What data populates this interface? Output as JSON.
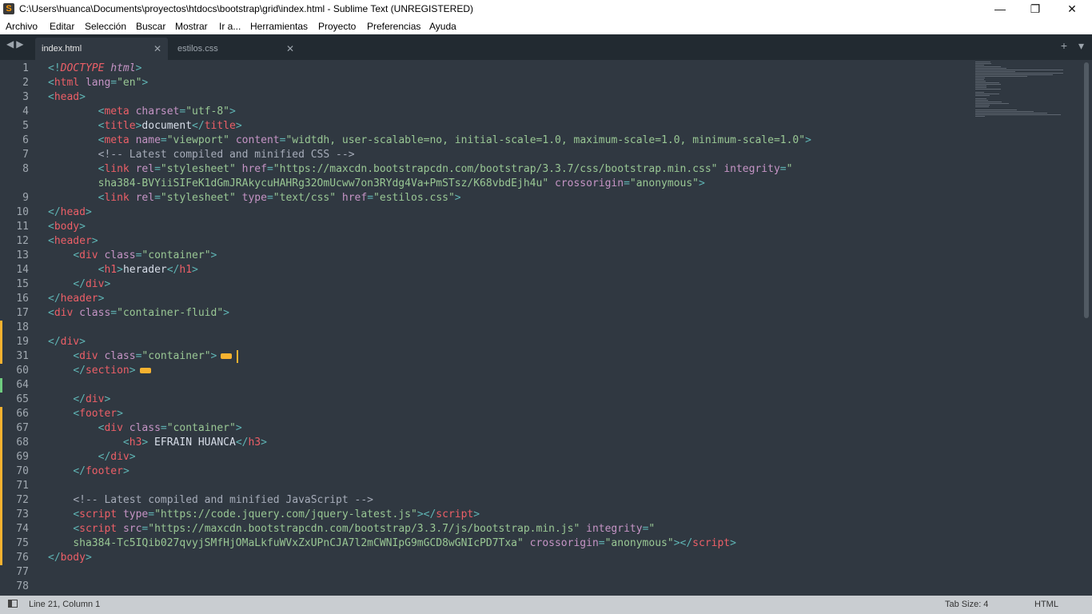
{
  "window": {
    "title": "C:\\Users\\huanca\\Documents\\proyectos\\htdocs\\bootstrap\\grid\\index.html - Sublime Text (UNREGISTERED)",
    "app_icon": "sublime-logo-icon",
    "minimize": "—",
    "maximize": "❐",
    "close": "✕"
  },
  "menu": [
    "Archivo",
    "Editar",
    "Selección",
    "Buscar",
    "Mostrar",
    "Ir a...",
    "Herramientas",
    "Proyecto",
    "Preferencias",
    "Ayuda"
  ],
  "tabs": [
    {
      "label": "index.html",
      "active": true
    },
    {
      "label": "estilos.css",
      "active": false
    }
  ],
  "tab_close_glyph": "✕",
  "nav": {
    "arrows": "◀▶",
    "new_tab": "+",
    "dropdown": "▾"
  },
  "lines": [
    {
      "n": "1",
      "html": "<span class='p'>&lt;!</span><span class='t'><i>DOCTYPE</i></span> <span class='a'><i>html</i></span><span class='p'>&gt;</span>"
    },
    {
      "n": "2",
      "html": "<span class='p'>&lt;</span><span class='t'>html</span> <span class='a'>lang</span><span class='p'>=</span><span class='s'>\"en\"</span><span class='p'>&gt;</span>"
    },
    {
      "n": "3",
      "html": "<span class='p'>&lt;</span><span class='t'>head</span><span class='p'>&gt;</span>"
    },
    {
      "n": "4",
      "html": "        <span class='p'>&lt;</span><span class='t'>meta</span> <span class='a'>charset</span><span class='p'>=</span><span class='s'>\"utf-8\"</span><span class='p'>&gt;</span>"
    },
    {
      "n": "5",
      "html": "        <span class='p'>&lt;</span><span class='t'>title</span><span class='p'>&gt;</span><span class='d'>document</span><span class='p'>&lt;/</span><span class='t'>title</span><span class='p'>&gt;</span>"
    },
    {
      "n": "6",
      "html": "        <span class='p'>&lt;</span><span class='t'>meta</span> <span class='a'>name</span><span class='p'>=</span><span class='s'>\"viewport\"</span> <span class='a'>content</span><span class='p'>=</span><span class='s'>\"widtdh, user-scalable=no, initial-scale=1.0, maximum-scale=1.0, minimum-scale=1.0\"</span><span class='p'>&gt;</span>"
    },
    {
      "n": "7",
      "html": "        <span class='c'>&lt;!-- Latest compiled and minified CSS --&gt;</span>"
    },
    {
      "n": "8",
      "html": "        <span class='p'>&lt;</span><span class='t'>link</span> <span class='a'>rel</span><span class='p'>=</span><span class='s'>\"stylesheet\"</span> <span class='a'>href</span><span class='p'>=</span><span class='s'>\"https://maxcdn.bootstrapcdn.com/bootstrap/3.3.7/css/bootstrap.min.css\"</span> <span class='a'>integrity</span><span class='p'>=</span><span class='s'>\"</span>"
    },
    {
      "n": "",
      "html": "        <span class='s'>sha384-BVYiiSIFeK1dGmJRAkycuHAHRg32OmUcww7on3RYdg4Va+PmSTsz/K68vbdEjh4u\"</span> <span class='a'>crossorigin</span><span class='p'>=</span><span class='s'>\"anonymous\"</span><span class='p'>&gt;</span>"
    },
    {
      "n": "9",
      "html": "        <span class='p'>&lt;</span><span class='t'>link</span> <span class='a'>rel</span><span class='p'>=</span><span class='s'>\"stylesheet\"</span> <span class='a'>type</span><span class='p'>=</span><span class='s'>\"text/css\"</span> <span class='a'>href</span><span class='p'>=</span><span class='s'>\"estilos.css\"</span><span class='p'>&gt;</span>"
    },
    {
      "n": "10",
      "html": "<span class='p'>&lt;/</span><span class='t'>head</span><span class='p'>&gt;</span>"
    },
    {
      "n": "11",
      "html": "<span class='p'>&lt;</span><span class='t'>body</span><span class='p'>&gt;</span>"
    },
    {
      "n": "12",
      "html": "<span class='p'>&lt;</span><span class='t'>header</span><span class='p'>&gt;</span>"
    },
    {
      "n": "13",
      "html": "    <span class='p'>&lt;</span><span class='t'>div</span> <span class='a'>class</span><span class='p'>=</span><span class='s'>\"container\"</span><span class='p'>&gt;</span>"
    },
    {
      "n": "14",
      "html": "        <span class='p'>&lt;</span><span class='t'>h1</span><span class='p'>&gt;</span><span class='d'>herader</span><span class='p'>&lt;/</span><span class='t'>h1</span><span class='p'>&gt;</span>"
    },
    {
      "n": "15",
      "html": "    <span class='p'>&lt;/</span><span class='t'>div</span><span class='p'>&gt;</span>"
    },
    {
      "n": "16",
      "html": "<span class='p'>&lt;/</span><span class='t'>header</span><span class='p'>&gt;</span>"
    },
    {
      "n": "17",
      "html": "<span class='p'>&lt;</span><span class='t'>div</span> <span class='a'>class</span><span class='p'>=</span><span class='s'>\"container-fluid\"</span><span class='p'>&gt;</span>"
    },
    {
      "n": "18",
      "html": ""
    },
    {
      "n": "19",
      "html": "<span class='p'>&lt;/</span><span class='t'>div</span><span class='p'>&gt;</span>"
    },
    {
      "n": "31",
      "html": "    <span class='p'>&lt;</span><span class='t'>div</span> <span class='a'>class</span><span class='p'>=</span><span class='s'>\"container\"</span><span class='p'>&gt;</span><span class='fold'></span><span class='caret'></span>"
    },
    {
      "n": "60",
      "html": "    <span class='p'>&lt;/</span><span class='t'>section</span><span class='p'>&gt;</span><span class='fold'></span>"
    },
    {
      "n": "64",
      "html": ""
    },
    {
      "n": "65",
      "html": "    <span class='p'>&lt;/</span><span class='t'>div</span><span class='p'>&gt;</span>"
    },
    {
      "n": "66",
      "html": "    <span class='p'>&lt;</span><span class='t'>footer</span><span class='p'>&gt;</span>"
    },
    {
      "n": "67",
      "html": "        <span class='p'>&lt;</span><span class='t'>div</span> <span class='a'>class</span><span class='p'>=</span><span class='s'>\"container\"</span><span class='p'>&gt;</span>"
    },
    {
      "n": "68",
      "html": "            <span class='p'>&lt;</span><span class='t'>h3</span><span class='p'>&gt;</span><span class='d'> EFRAIN HUANCA</span><span class='p'>&lt;/</span><span class='t'>h3</span><span class='p'>&gt;</span>"
    },
    {
      "n": "69",
      "html": "        <span class='p'>&lt;/</span><span class='t'>div</span><span class='p'>&gt;</span>"
    },
    {
      "n": "70",
      "html": "    <span class='p'>&lt;/</span><span class='t'>footer</span><span class='p'>&gt;</span>"
    },
    {
      "n": "71",
      "html": ""
    },
    {
      "n": "72",
      "html": "    <span class='c'>&lt;!-- Latest compiled and minified JavaScript --&gt;</span>"
    },
    {
      "n": "73",
      "html": "    <span class='p'>&lt;</span><span class='t'>script</span> <span class='a'>type</span><span class='p'>=</span><span class='s'>\"https://code.jquery.com/jquery-latest.js\"</span><span class='p'>&gt;&lt;/</span><span class='t'>script</span><span class='p'>&gt;</span>"
    },
    {
      "n": "74",
      "html": "    <span class='p'>&lt;</span><span class='t'>script</span> <span class='a'>src</span><span class='p'>=</span><span class='s'>\"https://maxcdn.bootstrapcdn.com/bootstrap/3.3.7/js/bootstrap.min.js\"</span> <span class='a'>integrity</span><span class='p'>=</span><span class='s'>\"</span>"
    },
    {
      "n": "75",
      "html": "    <span class='s'>sha384-Tc5IQib027qvyjSMfHjOMaLkfuWVxZxUPnCJA7l2mCWNIpG9mGCD8wGNIcPD7Txa\"</span> <span class='a'>crossorigin</span><span class='p'>=</span><span class='s'>\"anonymous\"</span><span class='p'>&gt;&lt;/</span><span class='t'>script</span><span class='p'>&gt;</span>"
    },
    {
      "n": "76",
      "html": "<span class='p'>&lt;/</span><span class='t'>body</span><span class='p'>&gt;</span>"
    },
    {
      "n": "77",
      "html": ""
    },
    {
      "n": "78",
      "html": ""
    }
  ],
  "status": {
    "position": "Line 21, Column 1",
    "tab_size": "Tab Size: 4",
    "syntax": "HTML"
  }
}
